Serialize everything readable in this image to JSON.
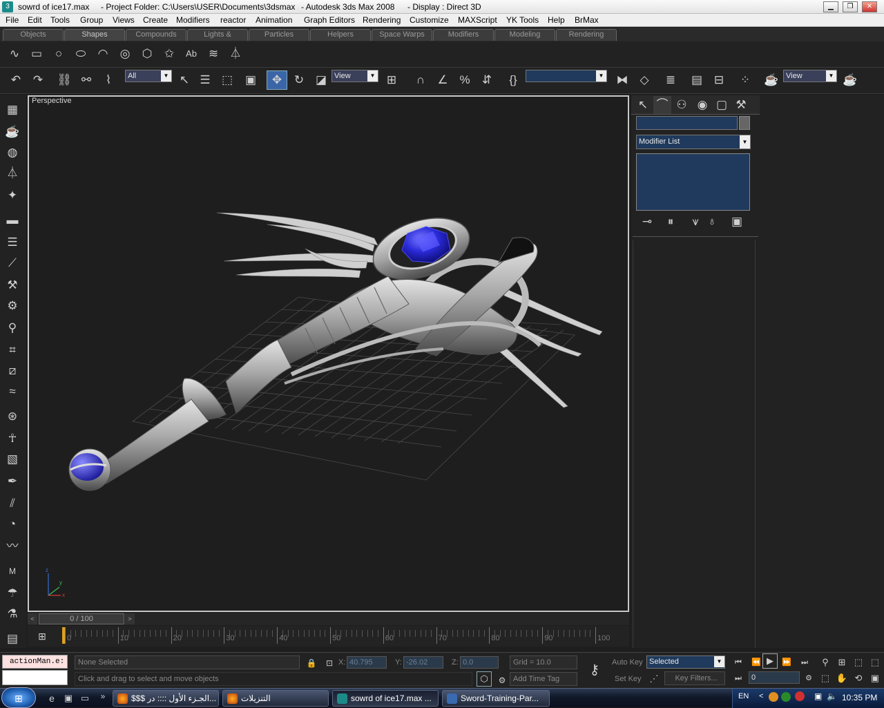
{
  "titlebar": {
    "file": "sowrd of ice17.max",
    "project": "- Project Folder: C:\\Users\\USER\\Documents\\3dsmax",
    "app": "- Autodesk 3ds Max 2008",
    "display": "- Display : Direct 3D"
  },
  "menu": [
    "File",
    "Edit",
    "Tools",
    "Group",
    "Views",
    "Create",
    "Modifiers",
    "reactor",
    "Animation",
    "Graph Editors",
    "Rendering",
    "Customize",
    "MAXScript",
    "YK Tools",
    "Help",
    "BrMax"
  ],
  "tabs": [
    "Objects",
    "Shapes",
    "Compounds",
    "Lights & Cameras",
    "Particles",
    "Helpers",
    "Space Warps",
    "Modifiers",
    "Modeling",
    "Rendering"
  ],
  "toolbar": {
    "selection_filter": "All",
    "ref_coord": "View",
    "named_selection": "",
    "render_view": "View"
  },
  "viewport": {
    "label": "Perspective"
  },
  "command_panel": {
    "name_field": "",
    "modifier_list": "Modifier List"
  },
  "timeline": {
    "frame_counter": "0 / 100",
    "ticks": [
      "0",
      "10",
      "20",
      "30",
      "40",
      "50",
      "60",
      "70",
      "80",
      "90",
      "100"
    ]
  },
  "status": {
    "maxscript": "actionMan.e:",
    "selection": "None Selected",
    "prompt": "Click and drag to select and move objects",
    "x_label": "X:",
    "x": "40.795",
    "y_label": "Y:",
    "y": "-26.02",
    "z_label": "Z:",
    "z": "0.0",
    "grid": "Grid = 10.0",
    "add_time_tag": "Add Time Tag",
    "auto_key": "Auto Key",
    "set_key": "Set Key",
    "key_mode": "Selected",
    "key_filters": "Key Filters...",
    "current_frame": "0"
  },
  "taskbar": {
    "items": [
      {
        "label": "$$$ الجـزء الأول :::: در..."
      },
      {
        "label": "التنزيلات"
      },
      {
        "label": "sowrd of ice17.max ..."
      },
      {
        "label": "Sword-Training-Par..."
      }
    ],
    "lang": "EN",
    "clock": "10:35 PM"
  },
  "colors": {
    "gem": "#2a2ad8",
    "viewport_bg": "#1e1e1e",
    "accent": "#1f3a5c"
  }
}
